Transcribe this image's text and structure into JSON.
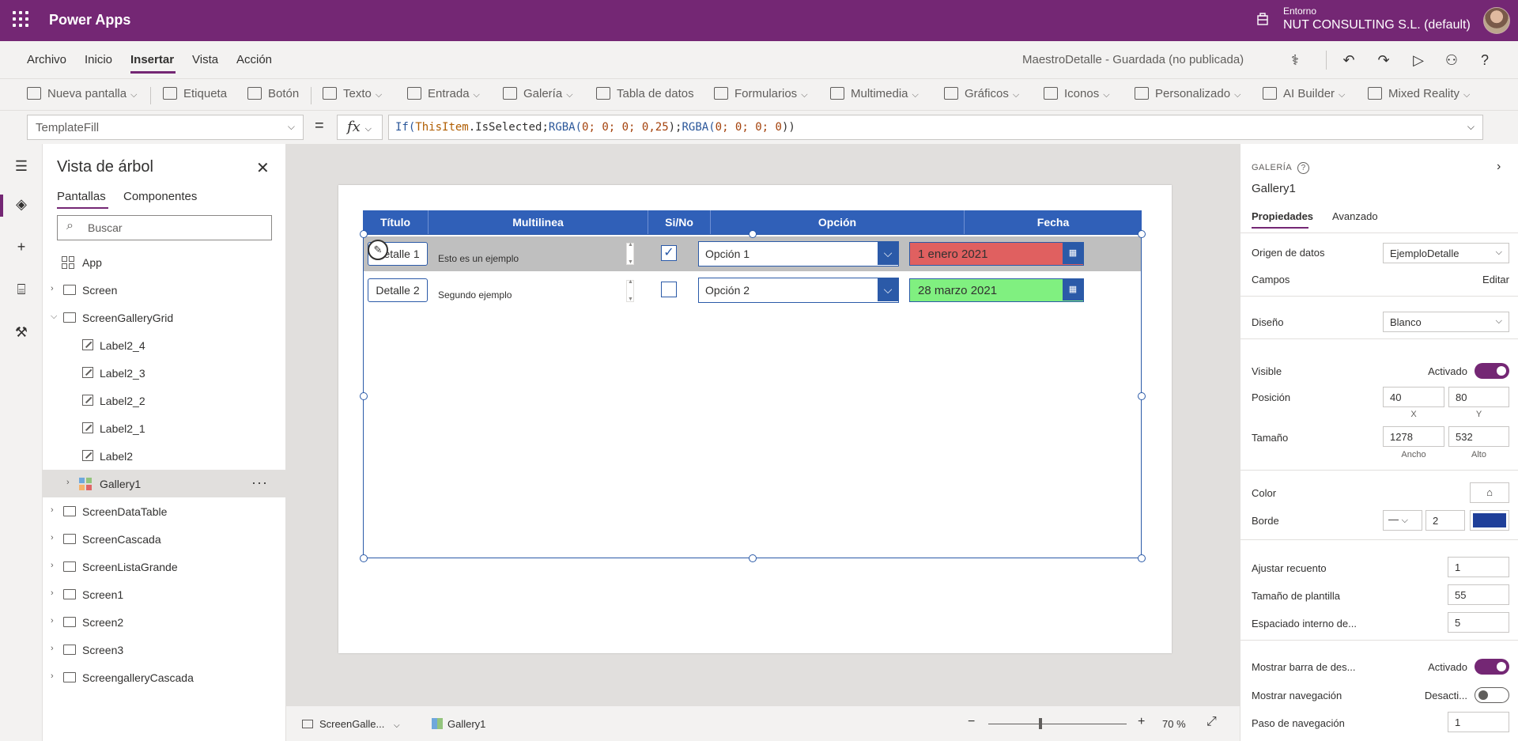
{
  "app": {
    "name": "Power Apps"
  },
  "environment": {
    "label": "Entorno",
    "value": "NUT CONSULTING S.L. (default)"
  },
  "menu": {
    "items": [
      "Archivo",
      "Inicio",
      "Insertar",
      "Vista",
      "Acción"
    ],
    "active": "Insertar",
    "doc_status": "MaestroDetalle - Guardada (no publicada)"
  },
  "ribbon": {
    "items": [
      "Nueva pantalla",
      "Etiqueta",
      "Botón",
      "Texto",
      "Entrada",
      "Galería",
      "Tabla de datos",
      "Formularios",
      "Multimedia",
      "Gráficos",
      "Iconos",
      "Personalizado",
      "AI Builder",
      "Mixed Reality"
    ]
  },
  "formula_bar": {
    "property": "TemplateFill",
    "equals": "=",
    "fx": "fx",
    "parts": {
      "fn1": "If(",
      "prop1": "ThisItem",
      "text1": ".IsSelected;",
      "fn2": "RGBA(",
      "nums1": "0; 0; 0; 0,25",
      "text2": ");",
      "fn3": "RGBA(",
      "nums2": "0; 0; 0; 0",
      "text3": "))"
    }
  },
  "tree": {
    "title": "Vista de árbol",
    "tabs": [
      "Pantallas",
      "Componentes"
    ],
    "search_placeholder": "Buscar",
    "items": [
      "App",
      "Screen",
      "ScreenGalleryGrid",
      "Label2_4",
      "Label2_3",
      "Label2_2",
      "Label2_1",
      "Label2",
      "Gallery1",
      "ScreenDataTable",
      "ScreenCascada",
      "ScreenListaGrande",
      "Screen1",
      "Screen2",
      "Screen3",
      "ScreengalleryCascada"
    ],
    "more": "···"
  },
  "gallery": {
    "headers": [
      "Título",
      "Multilinea",
      "Si/No",
      "Opción",
      "Fecha"
    ],
    "rows": [
      {
        "title": "Detalle 1",
        "multiline": "Esto es un ejemplo",
        "checked": "✓",
        "option": "Opción 1",
        "date": "1 enero 2021",
        "date_color": "#e06060"
      },
      {
        "title": "Detalle 2",
        "multiline": "Segundo ejemplo",
        "checked": "",
        "option": "Opción 2",
        "date": "28 marzo 2021",
        "date_color": "#80f080"
      }
    ]
  },
  "statusbar": {
    "screen": "ScreenGalle...",
    "control": "Gallery1",
    "minus": "−",
    "plus": "+",
    "zoom": "70",
    "zoom_unit": "%"
  },
  "properties": {
    "type": "GALERÍA",
    "name": "Gallery1",
    "tabs": [
      "Propiedades",
      "Avanzado"
    ],
    "datasource_label": "Origen de datos",
    "datasource_value": "EjemploDetalle",
    "fields_label": "Campos",
    "fields_action": "Editar",
    "design_label": "Diseño",
    "design_value": "Blanco",
    "visible_label": "Visible",
    "visible_value": "Activado",
    "position_label": "Posición",
    "x": "40",
    "y": "80",
    "x_label": "X",
    "y_label": "Y",
    "size_label": "Tamaño",
    "width": "1278",
    "height": "532",
    "width_label": "Ancho",
    "height_label": "Alto",
    "color_label": "Color",
    "border_label": "Borde",
    "border_width": "2",
    "border_color": "#1f3f99",
    "wrap_label": "Ajustar recuento",
    "wrap_value": "1",
    "template_size_label": "Tamaño de plantilla",
    "template_size_value": "55",
    "padding_label": "Espaciado interno de...",
    "padding_value": "5",
    "scrollbar_label": "Mostrar barra de des...",
    "scrollbar_value": "Activado",
    "nav_label": "Mostrar navegación",
    "nav_value": "Desacti...",
    "nav_step_label": "Paso de navegación",
    "nav_step_value": "1"
  },
  "colors": {
    "brand": "#742774",
    "accent": "#2b5aa8",
    "header": "#3060b8"
  }
}
